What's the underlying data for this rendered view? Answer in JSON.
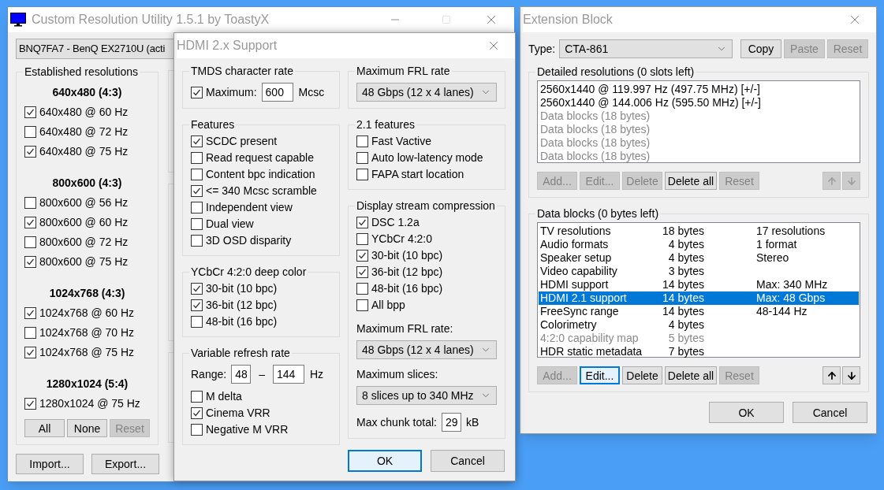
{
  "main_window": {
    "title": "Custom Resolution Utility 1.5.1 by ToastyX",
    "monitor": "BNQ7FA7 - BenQ EX2710U (acti",
    "resolutions": {
      "title": "Established resolutions",
      "groups": [
        {
          "heading": "640x480 (4:3)",
          "items": [
            {
              "label": "640x480 @ 60 Hz",
              "checked": true
            },
            {
              "label": "640x480 @ 72 Hz",
              "checked": false
            },
            {
              "label": "640x480 @ 75 Hz",
              "checked": true
            }
          ]
        },
        {
          "heading": "800x600 (4:3)",
          "items": [
            {
              "label": "800x600 @ 56 Hz",
              "checked": false
            },
            {
              "label": "800x600 @ 60 Hz",
              "checked": true
            },
            {
              "label": "800x600 @ 72 Hz",
              "checked": false
            },
            {
              "label": "800x600 @ 75 Hz",
              "checked": true
            }
          ]
        },
        {
          "heading": "1024x768 (4:3)",
          "items": [
            {
              "label": "1024x768 @ 60 Hz",
              "checked": true
            },
            {
              "label": "1024x768 @ 70 Hz",
              "checked": false
            },
            {
              "label": "1024x768 @ 75 Hz",
              "checked": true
            }
          ]
        },
        {
          "heading": "1280x1024 (5:4)",
          "items": [
            {
              "label": "1280x1024 @ 75 Hz",
              "checked": true
            }
          ]
        }
      ],
      "buttons": [
        {
          "label": "All",
          "disabled": false
        },
        {
          "label": "None",
          "disabled": false
        },
        {
          "label": "Reset",
          "disabled": true
        }
      ]
    },
    "buttons": [
      {
        "label": "Import...",
        "disabled": false
      },
      {
        "label": "Export...",
        "disabled": false
      }
    ]
  },
  "hdmi_dialog": {
    "title": "HDMI 2.x Support",
    "tmds": {
      "title": "TMDS character rate",
      "checked": true,
      "label": "Maximum:",
      "value": "600",
      "unit": "Mcsc"
    },
    "features": {
      "title": "Features",
      "items": [
        {
          "label": "SCDC present",
          "checked": true
        },
        {
          "label": "Read request capable",
          "checked": false
        },
        {
          "label": "Content bpc indication",
          "checked": false
        },
        {
          "label": "<= 340 Mcsc scramble",
          "checked": true
        },
        {
          "label": "Independent view",
          "checked": false
        },
        {
          "label": "Dual view",
          "checked": false
        },
        {
          "label": "3D OSD disparity",
          "checked": false
        }
      ]
    },
    "deep_color": {
      "title": "YCbCr 4:2:0 deep color",
      "items": [
        {
          "label": "30-bit (10 bpc)",
          "checked": true
        },
        {
          "label": "36-bit (12 bpc)",
          "checked": true
        },
        {
          "label": "48-bit (16 bpc)",
          "checked": false
        }
      ]
    },
    "vrr": {
      "title": "Variable refresh rate",
      "range_label": "Range:",
      "min": "48",
      "separator": "–",
      "max": "144",
      "unit": "Hz",
      "items": [
        {
          "label": "M delta",
          "checked": false
        },
        {
          "label": "Cinema VRR",
          "checked": true
        },
        {
          "label": "Negative M VRR",
          "checked": false
        }
      ]
    },
    "frl": {
      "title": "Maximum FRL rate",
      "value": "48 Gbps (12 x 4 lanes)"
    },
    "features_21": {
      "title": "2.1 features",
      "items": [
        {
          "label": "Fast Vactive",
          "checked": false
        },
        {
          "label": "Auto low-latency mode",
          "checked": false
        },
        {
          "label": "FAPA start location",
          "checked": false
        }
      ]
    },
    "dsc": {
      "title": "Display stream compression",
      "items": [
        {
          "label": "DSC 1.2a",
          "checked": true
        },
        {
          "label": "YCbCr 4:2:0",
          "checked": false
        },
        {
          "label": "30-bit (10 bpc)",
          "checked": true
        },
        {
          "label": "36-bit (12 bpc)",
          "checked": true
        },
        {
          "label": "48-bit (16 bpc)",
          "checked": false
        },
        {
          "label": "All bpp",
          "checked": false
        }
      ],
      "frl_label": "Maximum FRL rate:",
      "frl_value": "48 Gbps (12 x 4 lanes)",
      "slices_label": "Maximum slices:",
      "slices_value": "8 slices up to 340 MHz",
      "chunk_label": "Max chunk total:",
      "chunk_value": "29",
      "chunk_unit": "kB"
    },
    "buttons": [
      {
        "label": "OK",
        "disabled": false,
        "focused": true
      },
      {
        "label": "Cancel",
        "disabled": false,
        "focused": false
      }
    ]
  },
  "extension_block": {
    "title": "Extension Block",
    "type_label": "Type:",
    "type_value": "CTA-861",
    "top_buttons": [
      {
        "label": "Copy",
        "disabled": false
      },
      {
        "label": "Paste",
        "disabled": true
      },
      {
        "label": "Reset",
        "disabled": true
      }
    ],
    "detailed": {
      "title": "Detailed resolutions (0 slots left)",
      "items": [
        {
          "text": "2560x1440 @ 119.997 Hz (497.75 MHz) [+/-]",
          "disabled": false
        },
        {
          "text": "2560x1440 @ 144.006 Hz (595.50 MHz) [+/-]",
          "disabled": false
        },
        {
          "text": "Data blocks (18 bytes)",
          "disabled": true
        },
        {
          "text": "Data blocks (18 bytes)",
          "disabled": true
        },
        {
          "text": "Data blocks (18 bytes)",
          "disabled": true
        },
        {
          "text": "Data blocks (18 bytes)",
          "disabled": true
        }
      ],
      "buttons": [
        {
          "label": "Add...",
          "disabled": true,
          "focused": false
        },
        {
          "label": "Edit...",
          "disabled": true,
          "focused": false
        },
        {
          "label": "Delete",
          "disabled": true,
          "focused": false
        },
        {
          "label": "Delete all",
          "disabled": false,
          "focused": false
        },
        {
          "label": "Reset",
          "disabled": true,
          "focused": false
        }
      ],
      "arrows": [
        {
          "kind": "up",
          "disabled": true
        },
        {
          "kind": "down",
          "disabled": true
        }
      ]
    },
    "data_blocks": {
      "title": "Data blocks (0 bytes left)",
      "rows": [
        {
          "name": "TV resolutions",
          "size": "18 bytes",
          "info": "17 resolutions",
          "selected": false,
          "disabled": false
        },
        {
          "name": "Audio formats",
          "size": "4 bytes",
          "info": "1 format",
          "selected": false,
          "disabled": false
        },
        {
          "name": "Speaker setup",
          "size": "4 bytes",
          "info": "Stereo",
          "selected": false,
          "disabled": false
        },
        {
          "name": "Video capability",
          "size": "3 bytes",
          "selected": false,
          "disabled": false
        },
        {
          "name": "HDMI support",
          "size": "14 bytes",
          "info": "Max: 340 MHz",
          "selected": false,
          "disabled": false
        },
        {
          "name": "HDMI 2.1 support",
          "size": "14 bytes",
          "info": "Max: 48 Gbps",
          "selected": true,
          "disabled": false
        },
        {
          "name": "FreeSync range",
          "size": "14 bytes",
          "info": "48-144 Hz",
          "selected": false,
          "disabled": false
        },
        {
          "name": "Colorimetry",
          "size": "4 bytes",
          "selected": false,
          "disabled": false
        },
        {
          "name": "4:2:0 capability map",
          "size": "5 bytes",
          "selected": false,
          "disabled": true
        },
        {
          "name": "HDR static metadata",
          "size": "7 bytes",
          "selected": false,
          "disabled": false
        }
      ],
      "buttons": [
        {
          "label": "Add...",
          "disabled": true,
          "focused": false
        },
        {
          "label": "Edit...",
          "disabled": false,
          "focused": true
        },
        {
          "label": "Delete",
          "disabled": false,
          "focused": false
        },
        {
          "label": "Delete all",
          "disabled": false,
          "focused": false
        },
        {
          "label": "Reset",
          "disabled": true,
          "focused": false
        }
      ],
      "arrows": [
        {
          "kind": "up",
          "disabled": false
        },
        {
          "kind": "down",
          "disabled": false
        }
      ]
    },
    "buttons": [
      {
        "label": "OK",
        "disabled": false
      },
      {
        "label": "Cancel",
        "disabled": false
      }
    ]
  }
}
